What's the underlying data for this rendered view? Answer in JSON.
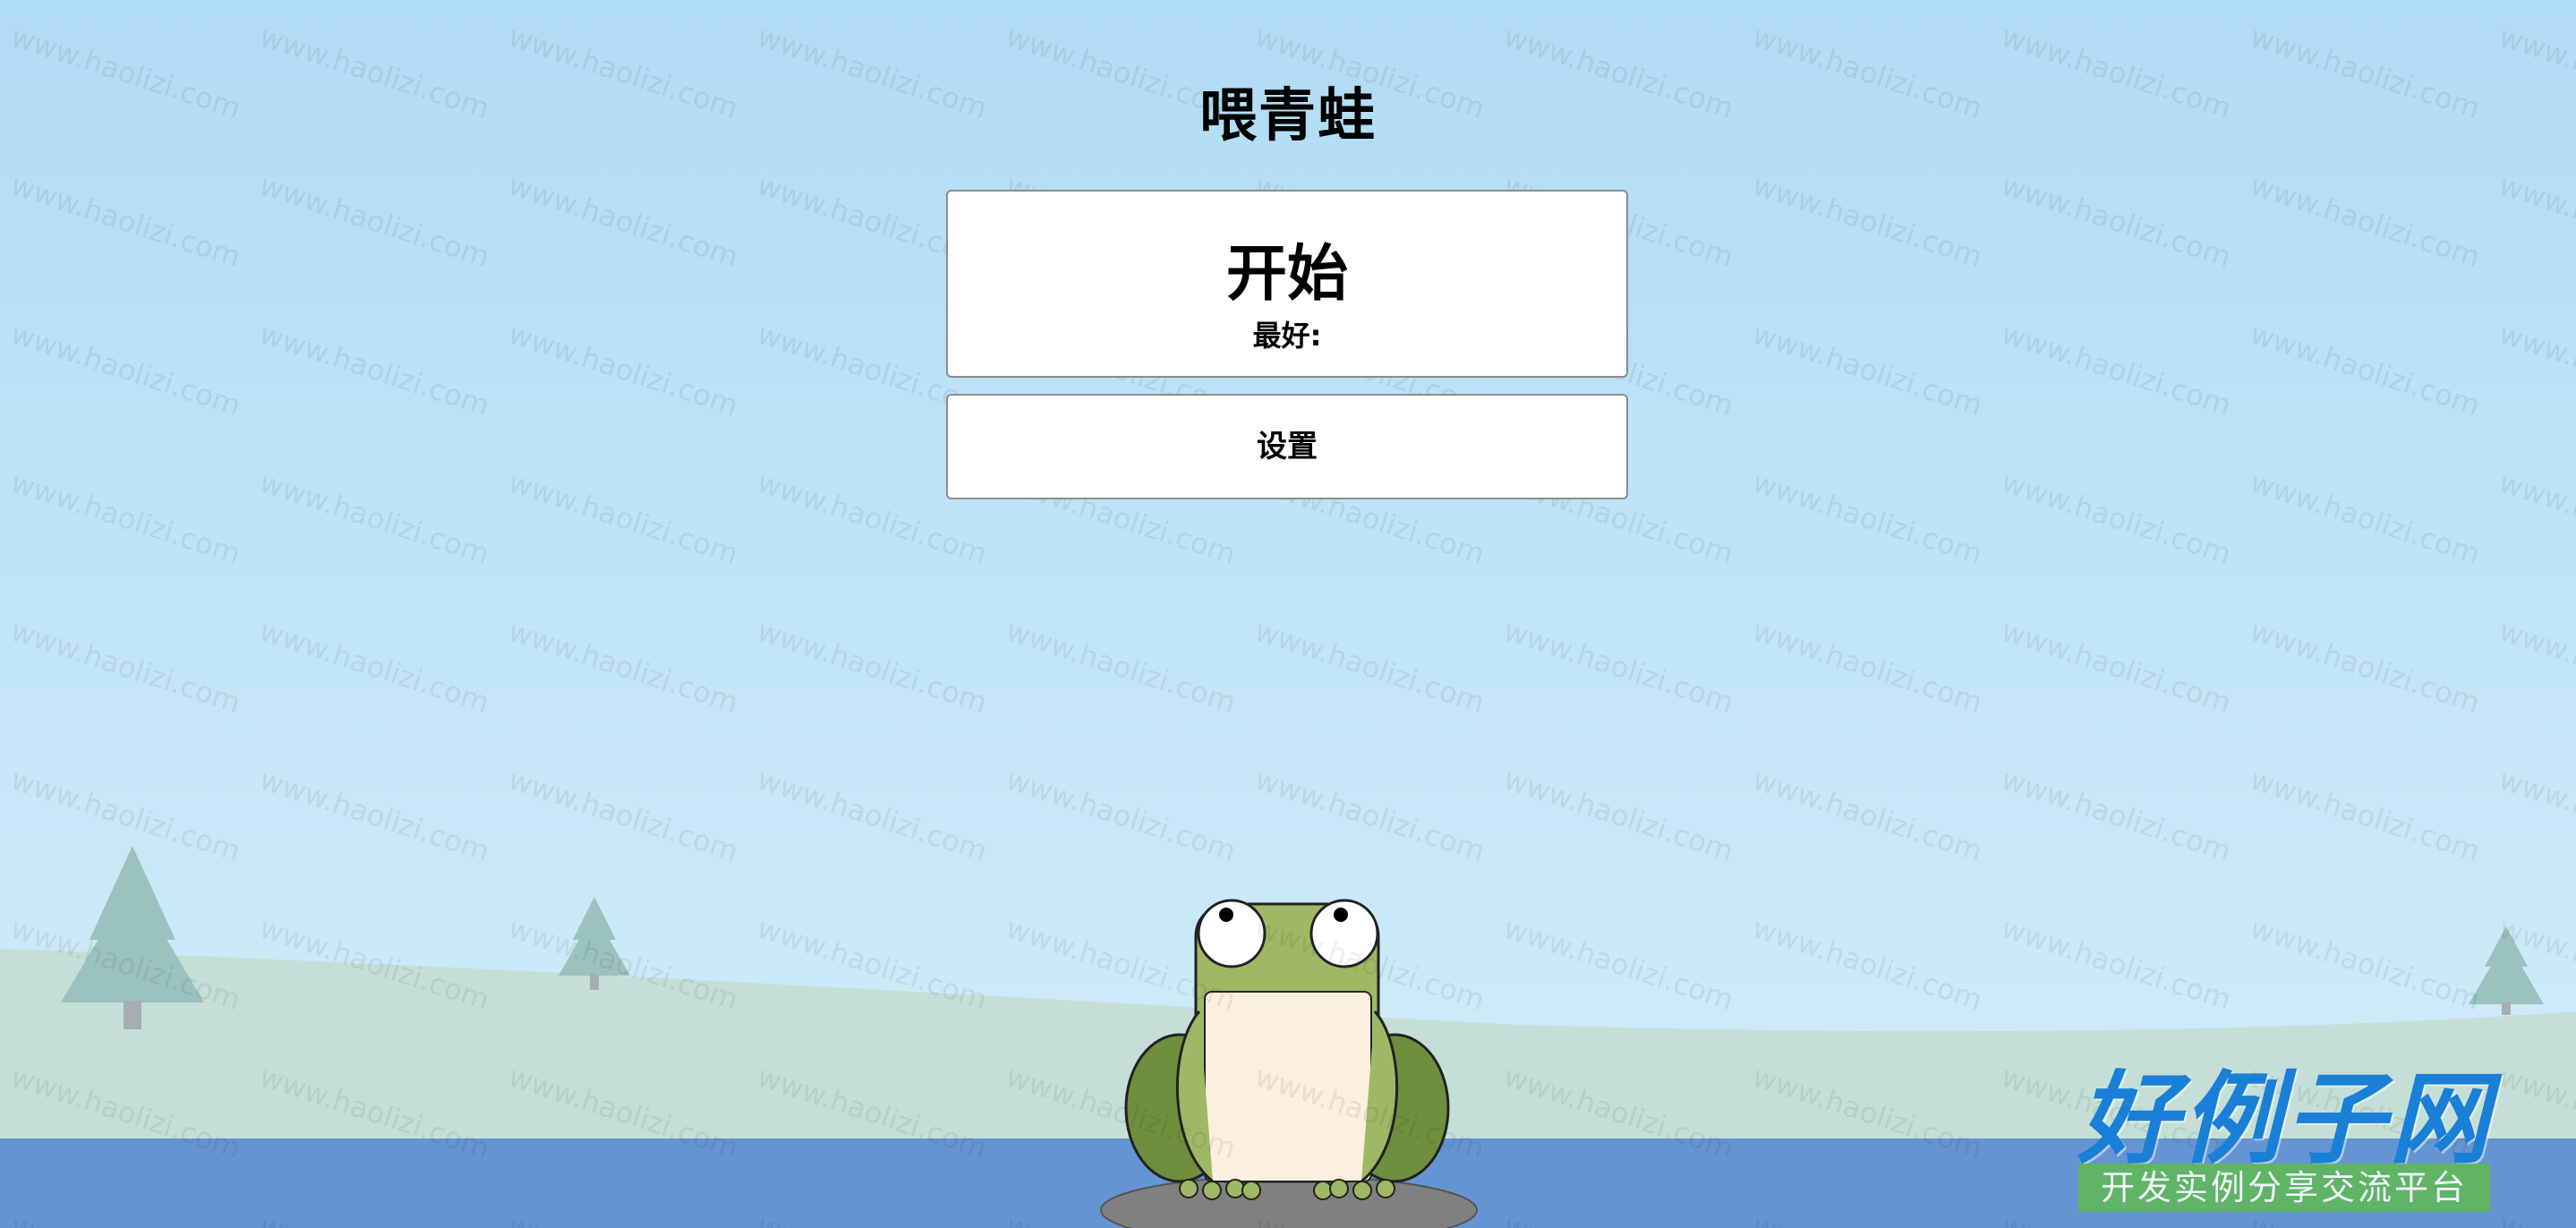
{
  "game": {
    "title": "喂青蛙",
    "start_label": "开始",
    "best_label": "最好:",
    "settings_label": "设置"
  },
  "watermark": {
    "repeat_text": "www.haolizi.com",
    "logo_text": "好例子网",
    "logo_subtitle": "开发实例分享交流平台"
  },
  "colors": {
    "sky_top": "#b0dcf4",
    "hill": "#c5dfd8",
    "tree": "#9bc2bf",
    "water": "#6495d2",
    "frog_body": "#9fb865",
    "frog_belly": "#fbefdd",
    "rock": "#808080"
  }
}
